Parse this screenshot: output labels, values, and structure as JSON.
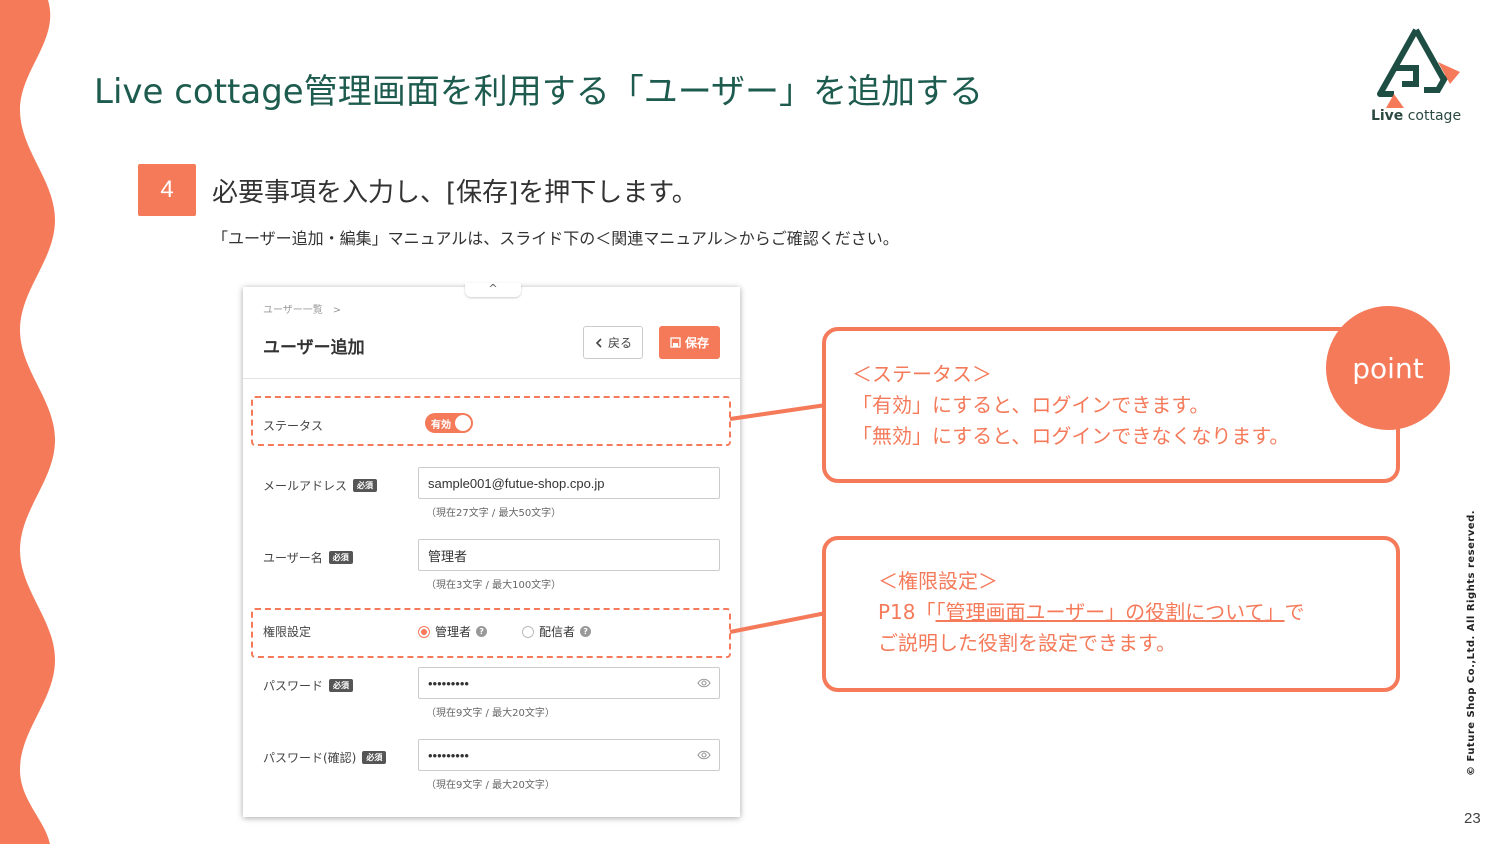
{
  "slide": {
    "title": "Live cottage管理画面を利用する「ユーザー」を追加する",
    "step_number": "4",
    "step_title": "必要事項を入力し、[保存]を押下します。",
    "step_subtitle": "「ユーザー追加・編集」マニュアルは、スライド下の＜関連マニュアル＞からご確認ください。",
    "logo_text_bold": "Live",
    "logo_text_rest": " cottage",
    "copyright": "© Future Shop Co.,Ltd. All Rights reserved.",
    "page_number": "23"
  },
  "form": {
    "collapse_icon": "^",
    "breadcrumb": "ユーザー一覧　>",
    "title": "ユーザー追加",
    "back_label": "戻る",
    "save_label": "保存",
    "required_badge": "必須",
    "status": {
      "label": "ステータス",
      "toggle_label": "有効",
      "enabled": true
    },
    "email": {
      "label": "メールアドレス",
      "value": "sample001@futue-shop.cpo.jp",
      "hint": "（現在27文字 / 最大50文字）"
    },
    "username": {
      "label": "ユーザー名",
      "value": "管理者",
      "hint": "（現在3文字 / 最大100文字）"
    },
    "role": {
      "label": "権限設定",
      "options": [
        "管理者",
        "配信者"
      ],
      "selected": "管理者"
    },
    "password": {
      "label": "パスワード",
      "value": "•••••••••",
      "hint": "（現在9文字 / 最大20文字）"
    },
    "password_confirm": {
      "label": "パスワード(確認)",
      "value": "•••••••••",
      "hint": "（現在9文字 / 最大20文字）"
    }
  },
  "callouts": {
    "point_label": "point",
    "status": {
      "heading": "＜ステータス＞",
      "line1": "「有効」にすると、ログインできます。",
      "line2": "「無効」にすると、ログインできなくなります。"
    },
    "role": {
      "heading": "＜権限設定＞",
      "line1_prefix": "P18「",
      "line1_link": "「管理画面ユーザー」の役割について」",
      "line1_suffix": "で",
      "line2": "ご説明した役割を設定できます。"
    }
  },
  "colors": {
    "accent": "#f47a5a",
    "title_green": "#1d5b4e"
  },
  "icons": [
    "wave-decoration",
    "logo-icon",
    "chevron-left-icon",
    "save-icon",
    "eye-icon",
    "help-icon"
  ]
}
